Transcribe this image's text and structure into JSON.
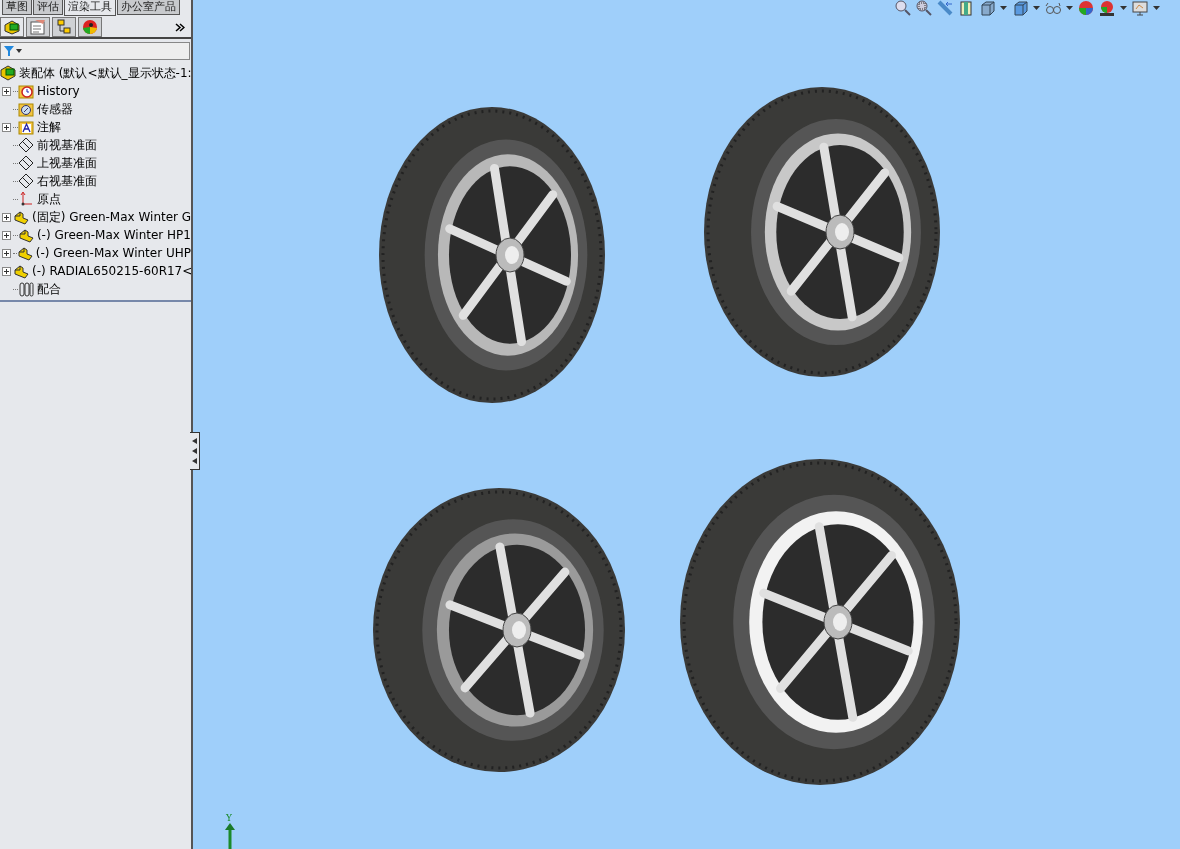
{
  "command_tabs": [
    {
      "label": "草图",
      "selected": false
    },
    {
      "label": "评估",
      "selected": false
    },
    {
      "label": "渲染工具",
      "selected": true
    },
    {
      "label": "办公室产品",
      "selected": false
    }
  ],
  "feature_tree": {
    "root": {
      "label": "装配体 (默认<默认_显示状态-1:",
      "kind": "assembly"
    },
    "items": [
      {
        "label": "History",
        "kind": "history",
        "expandable": true
      },
      {
        "label": "传感器",
        "kind": "sensor",
        "expandable": false
      },
      {
        "label": "注解",
        "kind": "annotation",
        "expandable": true
      },
      {
        "label": "前视基准面",
        "kind": "plane",
        "expandable": false
      },
      {
        "label": "上视基准面",
        "kind": "plane",
        "expandable": false
      },
      {
        "label": "右视基准面",
        "kind": "plane",
        "expandable": false
      },
      {
        "label": "原点",
        "kind": "origin",
        "expandable": false
      },
      {
        "label": "(固定) Green-Max Winter G",
        "kind": "part",
        "expandable": true
      },
      {
        "label": "(-) Green-Max Winter HP1",
        "kind": "part",
        "expandable": true
      },
      {
        "label": "(-) Green-Max Winter UHP",
        "kind": "part",
        "expandable": true
      },
      {
        "label": "(-) RADIAL650215-60R17<",
        "kind": "part",
        "expandable": true
      },
      {
        "label": "配合",
        "kind": "mates",
        "expandable": false
      }
    ]
  },
  "triad": {
    "y_label": "Y"
  }
}
